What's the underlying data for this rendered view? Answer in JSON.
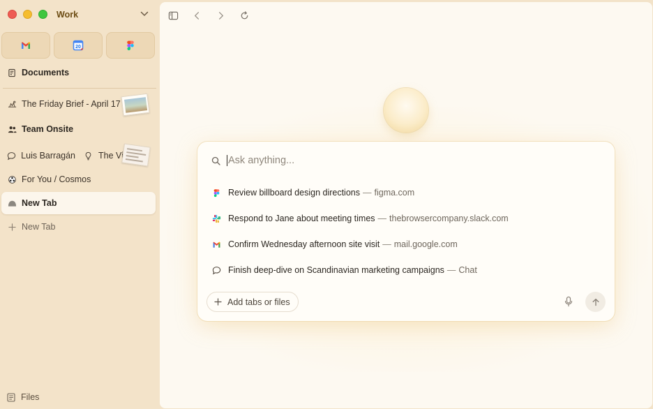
{
  "space": {
    "name": "Work"
  },
  "pinned": [
    {
      "icon": "gmail-icon"
    },
    {
      "icon": "calendar-icon",
      "day": "20"
    },
    {
      "icon": "figma-icon"
    }
  ],
  "sidebar": {
    "documents": "Documents",
    "friday_brief": "The Friday Brief - April 17",
    "team_onsite": "Team Onsite",
    "split_left": "Luis Barragán",
    "split_right": "The Vi",
    "for_you": "For You / Cosmos",
    "active_tab": "New Tab",
    "new_tab": "New Tab",
    "files": "Files"
  },
  "command": {
    "placeholder": "Ask anything...",
    "suggestions": [
      {
        "icon": "figma-icon",
        "title": "Review billboard design directions",
        "source": "figma.com"
      },
      {
        "icon": "slack-icon",
        "title": "Respond to Jane about meeting times",
        "source": "thebrowsercompany.slack.com"
      },
      {
        "icon": "gmail-icon",
        "title": "Confirm Wednesday afternoon site visit",
        "source": "mail.google.com"
      },
      {
        "icon": "chat-bubble-icon",
        "title": "Finish deep-dive on Scandinavian marketing campaigns",
        "source": "Chat"
      }
    ],
    "separator": "—",
    "add_label": "Add tabs or files"
  },
  "colors": {
    "sidebar_bg": "#f3e3c9",
    "content_bg": "#fdf9f1",
    "space_label": "#6b4b12"
  }
}
